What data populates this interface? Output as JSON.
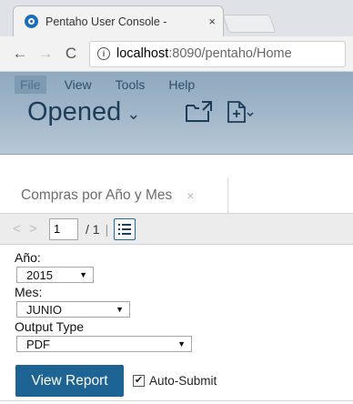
{
  "browser": {
    "tab_title": "Pentaho User Console - ",
    "tab_close": "×",
    "back": "←",
    "forward": "→",
    "reload": "C",
    "info": "i",
    "url_host": "localhost",
    "url_rest": ":8090/pentaho/Home"
  },
  "menu": {
    "items": [
      "File",
      "View",
      "Tools",
      "Help"
    ],
    "active_item": "File"
  },
  "header": {
    "perspective": "Opened",
    "chevron": "⌄"
  },
  "report_tab": {
    "title": "Compras por Año y Mes",
    "close": "×"
  },
  "paging": {
    "prev": "<",
    "next": ">",
    "current_page": "1",
    "total": "/ 1",
    "separator": "|"
  },
  "params": {
    "year": {
      "label": "Año:",
      "value": "2015"
    },
    "month": {
      "label": "Mes:",
      "value": "JUNIO"
    },
    "output": {
      "label": "Output Type",
      "value": "PDF"
    },
    "dropdown_arrow": "▼"
  },
  "actions": {
    "view_report": "View Report",
    "auto_submit_label": "Auto-Submit",
    "auto_submit_checked": true,
    "check_mark": "✔"
  },
  "colors": {
    "accent": "#1d6495",
    "header_gradient_top": "#8fa9bf",
    "header_text": "#1d3c58"
  }
}
